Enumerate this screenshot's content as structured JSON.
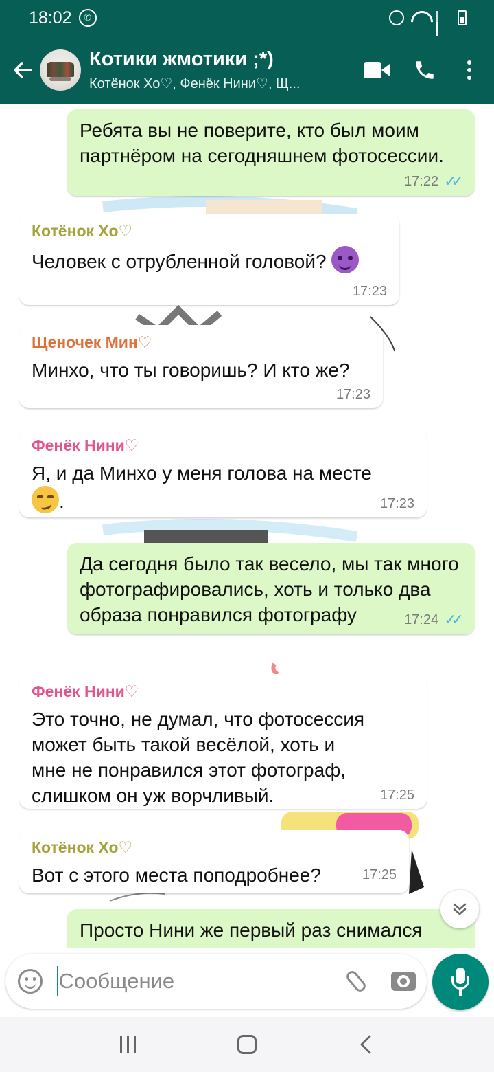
{
  "status_bar": {
    "time": "18:02",
    "app_icon": "whatsapp-icon",
    "icons": [
      "alarm-icon",
      "wifi-icon",
      "signal-icon",
      "battery-charging-icon"
    ]
  },
  "header": {
    "back_icon": "back-arrow-icon",
    "title": "Котики жмотики ;*)",
    "subtitle": "Котёнок Хо♡, Фенёк Нини♡, Щ...",
    "actions": [
      "video-call-icon",
      "voice-call-icon",
      "more-options-icon"
    ]
  },
  "colors": {
    "header_bg": "#075e54",
    "outgoing_bubble": "#dcf8c6",
    "incoming_bubble": "#ffffff",
    "read_ticks": "#4fb4e8",
    "mic_button": "#00897b",
    "sender_hokitten": "#a3a33a",
    "sender_min": "#e0703a",
    "sender_nini": "#e05590"
  },
  "messages": [
    {
      "direction": "out",
      "text": "Ребята вы не поверите, кто был моим партнёром на сегодняшнем фотосессии.",
      "time": "17:22",
      "read": "✓✓"
    },
    {
      "direction": "in",
      "sender": "Котёнок Хо♡",
      "text": "Человек с отрубленной головой? ",
      "emoji": "smiling-devil-emoji",
      "time": "17:23"
    },
    {
      "direction": "in",
      "sender": "Щеночек Мин♡",
      "text": "Минхо, что ты говоришь? И кто же?",
      "time": "17:23"
    },
    {
      "direction": "in",
      "sender": "Фенёк Нини♡",
      "text": "Я, и да Минхо у меня голова на месте",
      "emoji": "smirking-face-emoji",
      "text_after": ".",
      "time": "17:23"
    },
    {
      "direction": "out",
      "text": "Да сегодня было так весело, мы так много фотографировались, хоть и только два образа понравился фотографу",
      "time": "17:24",
      "read": "✓✓"
    },
    {
      "direction": "in",
      "sender": "Фенёк Нини♡",
      "text": "Это точно, не думал, что фотосессия может быть такой весёлой, хоть и мне не понравился этот фотограф, слишком он уж ворчливый.",
      "time": "17:25"
    },
    {
      "direction": "in",
      "sender": "Котёнок Хо♡",
      "text": "Вот с этого места поподробнее?",
      "time": "17:25"
    },
    {
      "direction": "out",
      "text": "Просто Нини же первый раз снимался",
      "partial": true
    }
  ],
  "scroll_down_icon": "double-chevron-down-icon",
  "composer": {
    "emoji_icon": "emoji-icon",
    "placeholder": "Сообщение",
    "value": "",
    "attach_icon": "paperclip-icon",
    "camera_icon": "camera-icon",
    "mic_icon": "microphone-icon"
  },
  "nav_bar": [
    "recent-apps-icon",
    "home-icon",
    "back-icon"
  ]
}
